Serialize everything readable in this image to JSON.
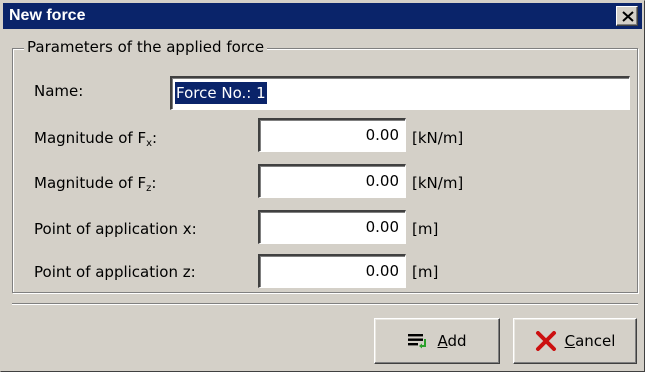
{
  "window": {
    "title": "New force"
  },
  "group": {
    "legend": "Parameters of the applied force"
  },
  "name": {
    "label": "Name:",
    "value": "Force No.: 1"
  },
  "fields": [
    {
      "label": "Magnitude of  F",
      "subscript": "x",
      "suffix": ":",
      "value": "0.00",
      "unit": "[kN/m]"
    },
    {
      "label": "Magnitude of  F",
      "subscript": "z",
      "suffix": ":",
      "value": "0.00",
      "unit": "[kN/m]"
    },
    {
      "label": "Point of application x:",
      "subscript": "",
      "suffix": "",
      "value": "0.00",
      "unit": "[m]"
    },
    {
      "label": "Point of application z:",
      "subscript": "",
      "suffix": "",
      "value": "0.00",
      "unit": "[m]"
    }
  ],
  "buttons": {
    "add": {
      "accel": "A",
      "rest": "dd",
      "icon": "add-list-icon"
    },
    "cancel": {
      "accel": "C",
      "rest": "ancel",
      "icon": "red-x-icon"
    }
  },
  "colors": {
    "titlebar": "#0a246a",
    "face": "#d4d0c8",
    "selection": "#0a246a",
    "cancel_icon": "#cc1010",
    "add_icon_arrow": "#2aa02a"
  }
}
